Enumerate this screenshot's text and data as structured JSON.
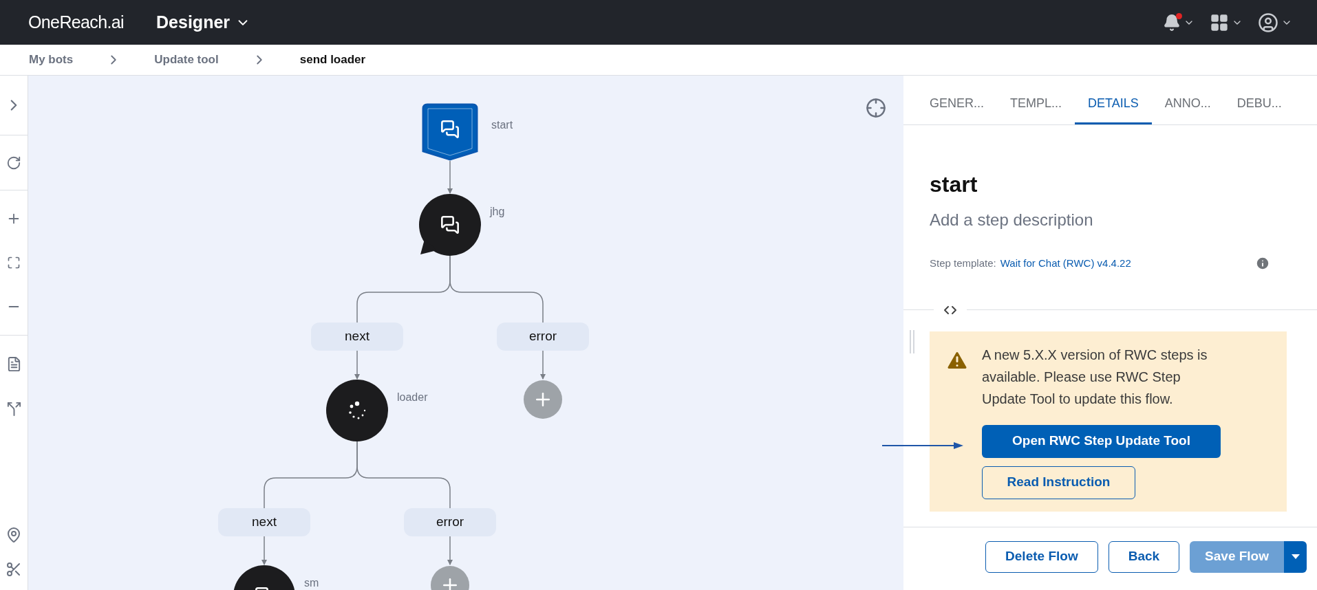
{
  "header": {
    "logo": "OneReach.ai",
    "app_name": "Designer",
    "has_unread_notifications": true
  },
  "breadcrumbs": [
    {
      "label": "My bots",
      "selected": false
    },
    {
      "label": "Update tool",
      "selected": false
    },
    {
      "label": "send loader",
      "selected": true
    }
  ],
  "flow": [
    {
      "kind": "start",
      "label": "start"
    },
    {
      "kind": "chat",
      "label": "jhg",
      "exits": [
        {
          "label": "next"
        },
        {
          "label": "error"
        }
      ]
    },
    {
      "kind": "loader",
      "label": "loader",
      "exits": [
        {
          "label": "next"
        },
        {
          "label": "error"
        }
      ]
    },
    {
      "kind": "chat",
      "label": "sm"
    }
  ],
  "panel": {
    "tabs": [
      {
        "label": "GENER...",
        "selected": false
      },
      {
        "label": "TEMPL...",
        "selected": false
      },
      {
        "label": "DETAILS",
        "selected": true
      },
      {
        "label": "ANNO...",
        "selected": false
      },
      {
        "label": "DEBU...",
        "selected": false
      }
    ],
    "step_title": "start",
    "description_hint": "Add a step description",
    "template_label": "Step template:",
    "template_link": "Wait for Chat (RWC) v4.4.22",
    "alert": {
      "message": "A new 5.X.X version of RWC steps is available. Please use RWC Step Update Tool to update this flow.",
      "primary_button": "Open RWC Step Update Tool",
      "secondary_button": "Read Instruction"
    },
    "footer_buttons": [
      {
        "label": "Delete Flow",
        "kind": "outline",
        "disabled": false
      },
      {
        "label": "Back",
        "kind": "outline",
        "disabled": false
      },
      {
        "label": "Save Flow",
        "kind": "split",
        "disabled": true
      }
    ]
  }
}
